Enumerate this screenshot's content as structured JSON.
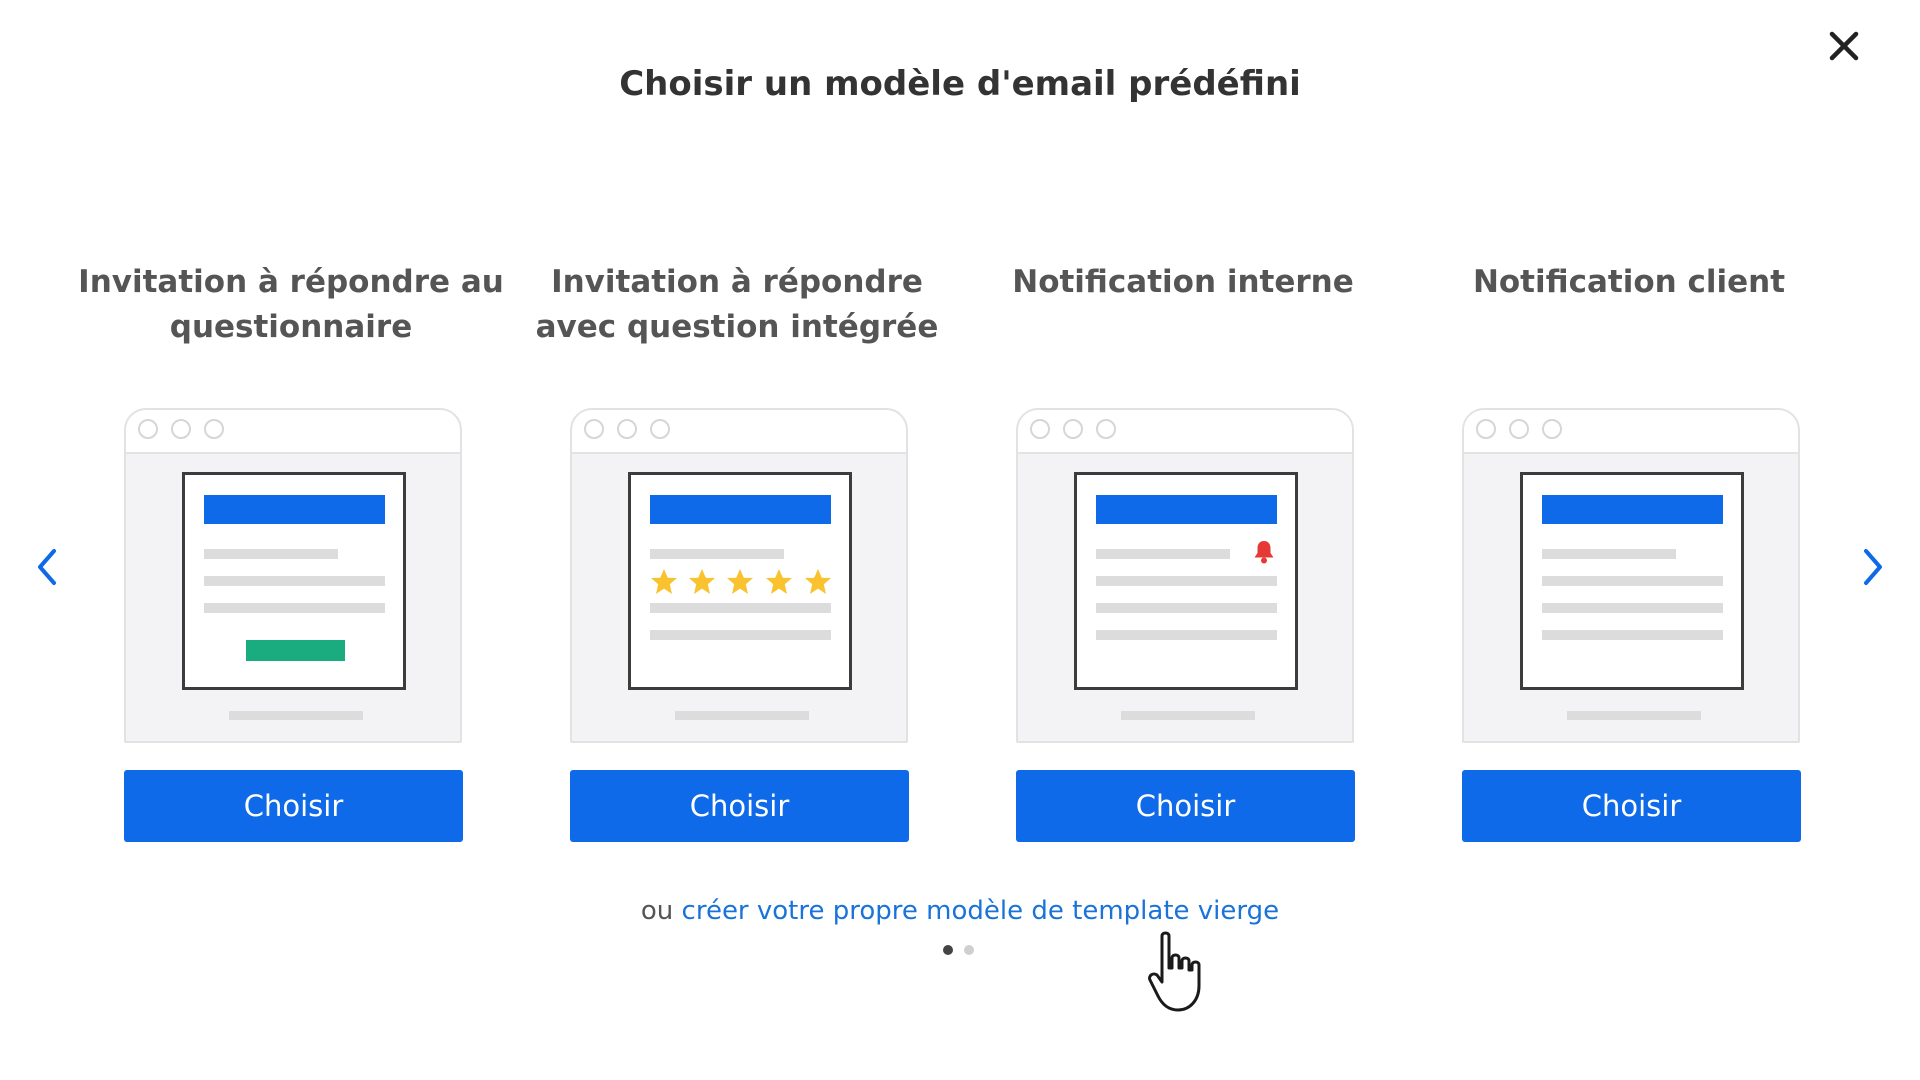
{
  "modal": {
    "title": "Choisir un modèle d'email prédéfini",
    "close_icon": "close-icon",
    "prev_icon": "chevron-left-icon",
    "next_icon": "chevron-right-icon"
  },
  "templates": [
    {
      "title": "Invitation à répondre au questionnaire",
      "button_label": "Choisir",
      "preview_icon": "email-cta-icon"
    },
    {
      "title": "Invitation à répondre avec question intégrée",
      "button_label": "Choisir",
      "preview_icon": "star-rating-icon"
    },
    {
      "title": "Notification interne",
      "button_label": "Choisir",
      "preview_icon": "bell-icon"
    },
    {
      "title": "Notification client",
      "button_label": "Choisir",
      "preview_icon": "email-text-icon"
    }
  ],
  "footer": {
    "prefix": "ou",
    "link_text": "créer votre propre modèle de template vierge"
  },
  "pagination": {
    "pages": 2,
    "current": 1
  },
  "colors": {
    "accent": "#0e6ae8",
    "cta_green": "#1aab7e",
    "star_yellow": "#f9c22e",
    "bell_red": "#e53935",
    "link_blue": "#1a73d9",
    "title_text": "#333333",
    "card_title_text": "#555555"
  }
}
